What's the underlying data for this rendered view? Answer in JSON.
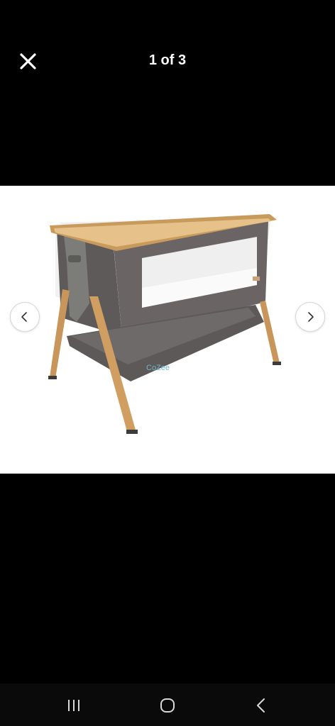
{
  "header": {
    "counter_text": "1 of 3"
  },
  "image": {
    "brand_text": "CoZee"
  },
  "icons": {
    "close": "close-icon",
    "prev": "chevron-left-icon",
    "next": "chevron-right-icon",
    "recents": "recents-icon",
    "home": "home-icon",
    "back": "back-icon"
  }
}
